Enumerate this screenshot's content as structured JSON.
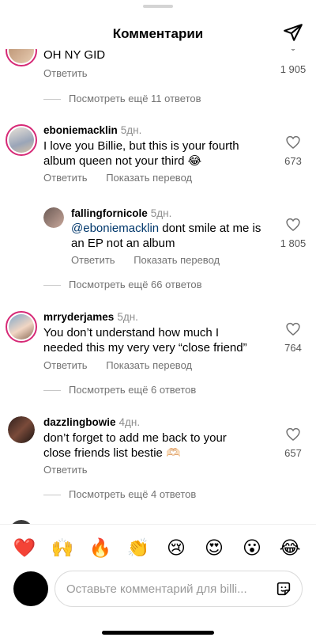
{
  "header": {
    "title": "Комментарии"
  },
  "comments": [
    {
      "text": "OH NY GID",
      "reply_label": "Ответить",
      "likes": "1 905",
      "more_replies": "Посмотреть ещё 11 ответов"
    },
    {
      "username": "eboniemacklin",
      "time": "5дн.",
      "text": "I love you Billie, but this is your fourth album queen not your third 😂",
      "reply_label": "Ответить",
      "translate_label": "Показать перевод",
      "likes": "673",
      "reply": {
        "username": "fallingfornicole",
        "time": "5дн.",
        "mention": "@eboniemacklin",
        "text": " dont smile at me is an EP not an album",
        "reply_label": "Ответить",
        "translate_label": "Показать перевод",
        "likes": "1 805"
      },
      "more_replies": "Посмотреть ещё 66 ответов"
    },
    {
      "username": "mrryderjames",
      "time": "5дн.",
      "text": "You don’t understand how much I needed this my very very “close friend”",
      "reply_label": "Ответить",
      "translate_label": "Показать перевод",
      "likes": "764",
      "more_replies": "Посмотреть ещё 6 ответов"
    },
    {
      "username": "dazzlingbowie",
      "time": "4дн.",
      "text": "don’t forget to add me back to your close friends list bestie 🫶🏻",
      "reply_label": "Ответить",
      "likes": "657",
      "more_replies": "Посмотреть ещё 4 ответов"
    }
  ],
  "emoji_bar": [
    "❤️",
    "🙌",
    "🔥",
    "👏",
    "😢",
    "😍",
    "😮",
    "😂"
  ],
  "composer": {
    "placeholder": "Оставьте комментарий для billi..."
  },
  "colors": {
    "story_ring": "#d62976",
    "mention": "#00376b",
    "secondary_text": "#737373"
  }
}
